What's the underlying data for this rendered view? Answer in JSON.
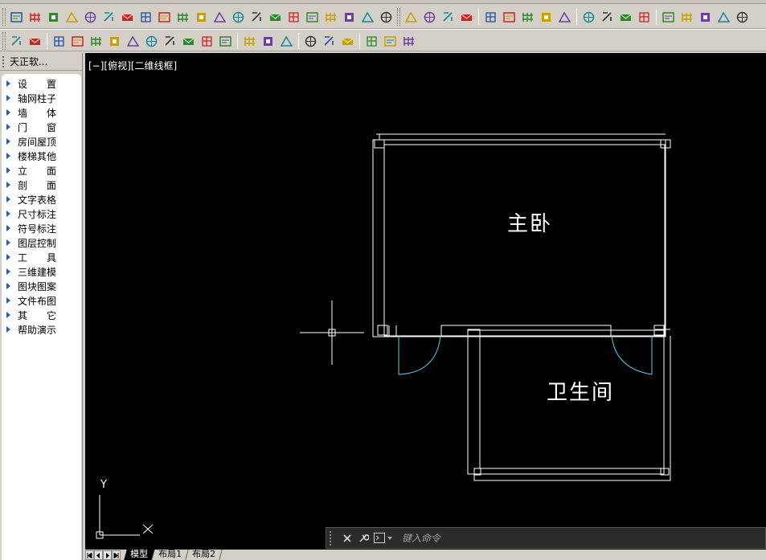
{
  "palette": {
    "title": "天正软...",
    "items": [
      {
        "label": "设　置"
      },
      {
        "label": "轴网柱子"
      },
      {
        "label": "墙　体"
      },
      {
        "label": "门　窗"
      },
      {
        "label": "房间屋顶"
      },
      {
        "label": "楼梯其他"
      },
      {
        "label": "立　面"
      },
      {
        "label": "剖　面"
      },
      {
        "label": "文字表格"
      },
      {
        "label": "尺寸标注"
      },
      {
        "label": "符号标注"
      },
      {
        "label": "图层控制"
      },
      {
        "label": "工　具"
      },
      {
        "label": "三维建模"
      },
      {
        "label": "图块图案"
      },
      {
        "label": "文件布图"
      },
      {
        "label": "其　它"
      },
      {
        "label": "帮助演示"
      }
    ]
  },
  "canvas": {
    "view_label": "[−][俯视][二维线框]",
    "room_labels": {
      "master_bedroom": "主卧",
      "bathroom": "卫生间"
    },
    "ucs": {
      "x_label": "X",
      "y_label": "Y"
    },
    "colors": {
      "wall": "#ffffff",
      "door_arc": "#5ad2e6",
      "background": "#000000"
    }
  },
  "command": {
    "placeholder": "键入命令"
  },
  "tabs": {
    "items": [
      {
        "label": "模型",
        "active": true
      },
      {
        "label": "布局1",
        "active": false
      },
      {
        "label": "布局2",
        "active": false
      }
    ]
  }
}
